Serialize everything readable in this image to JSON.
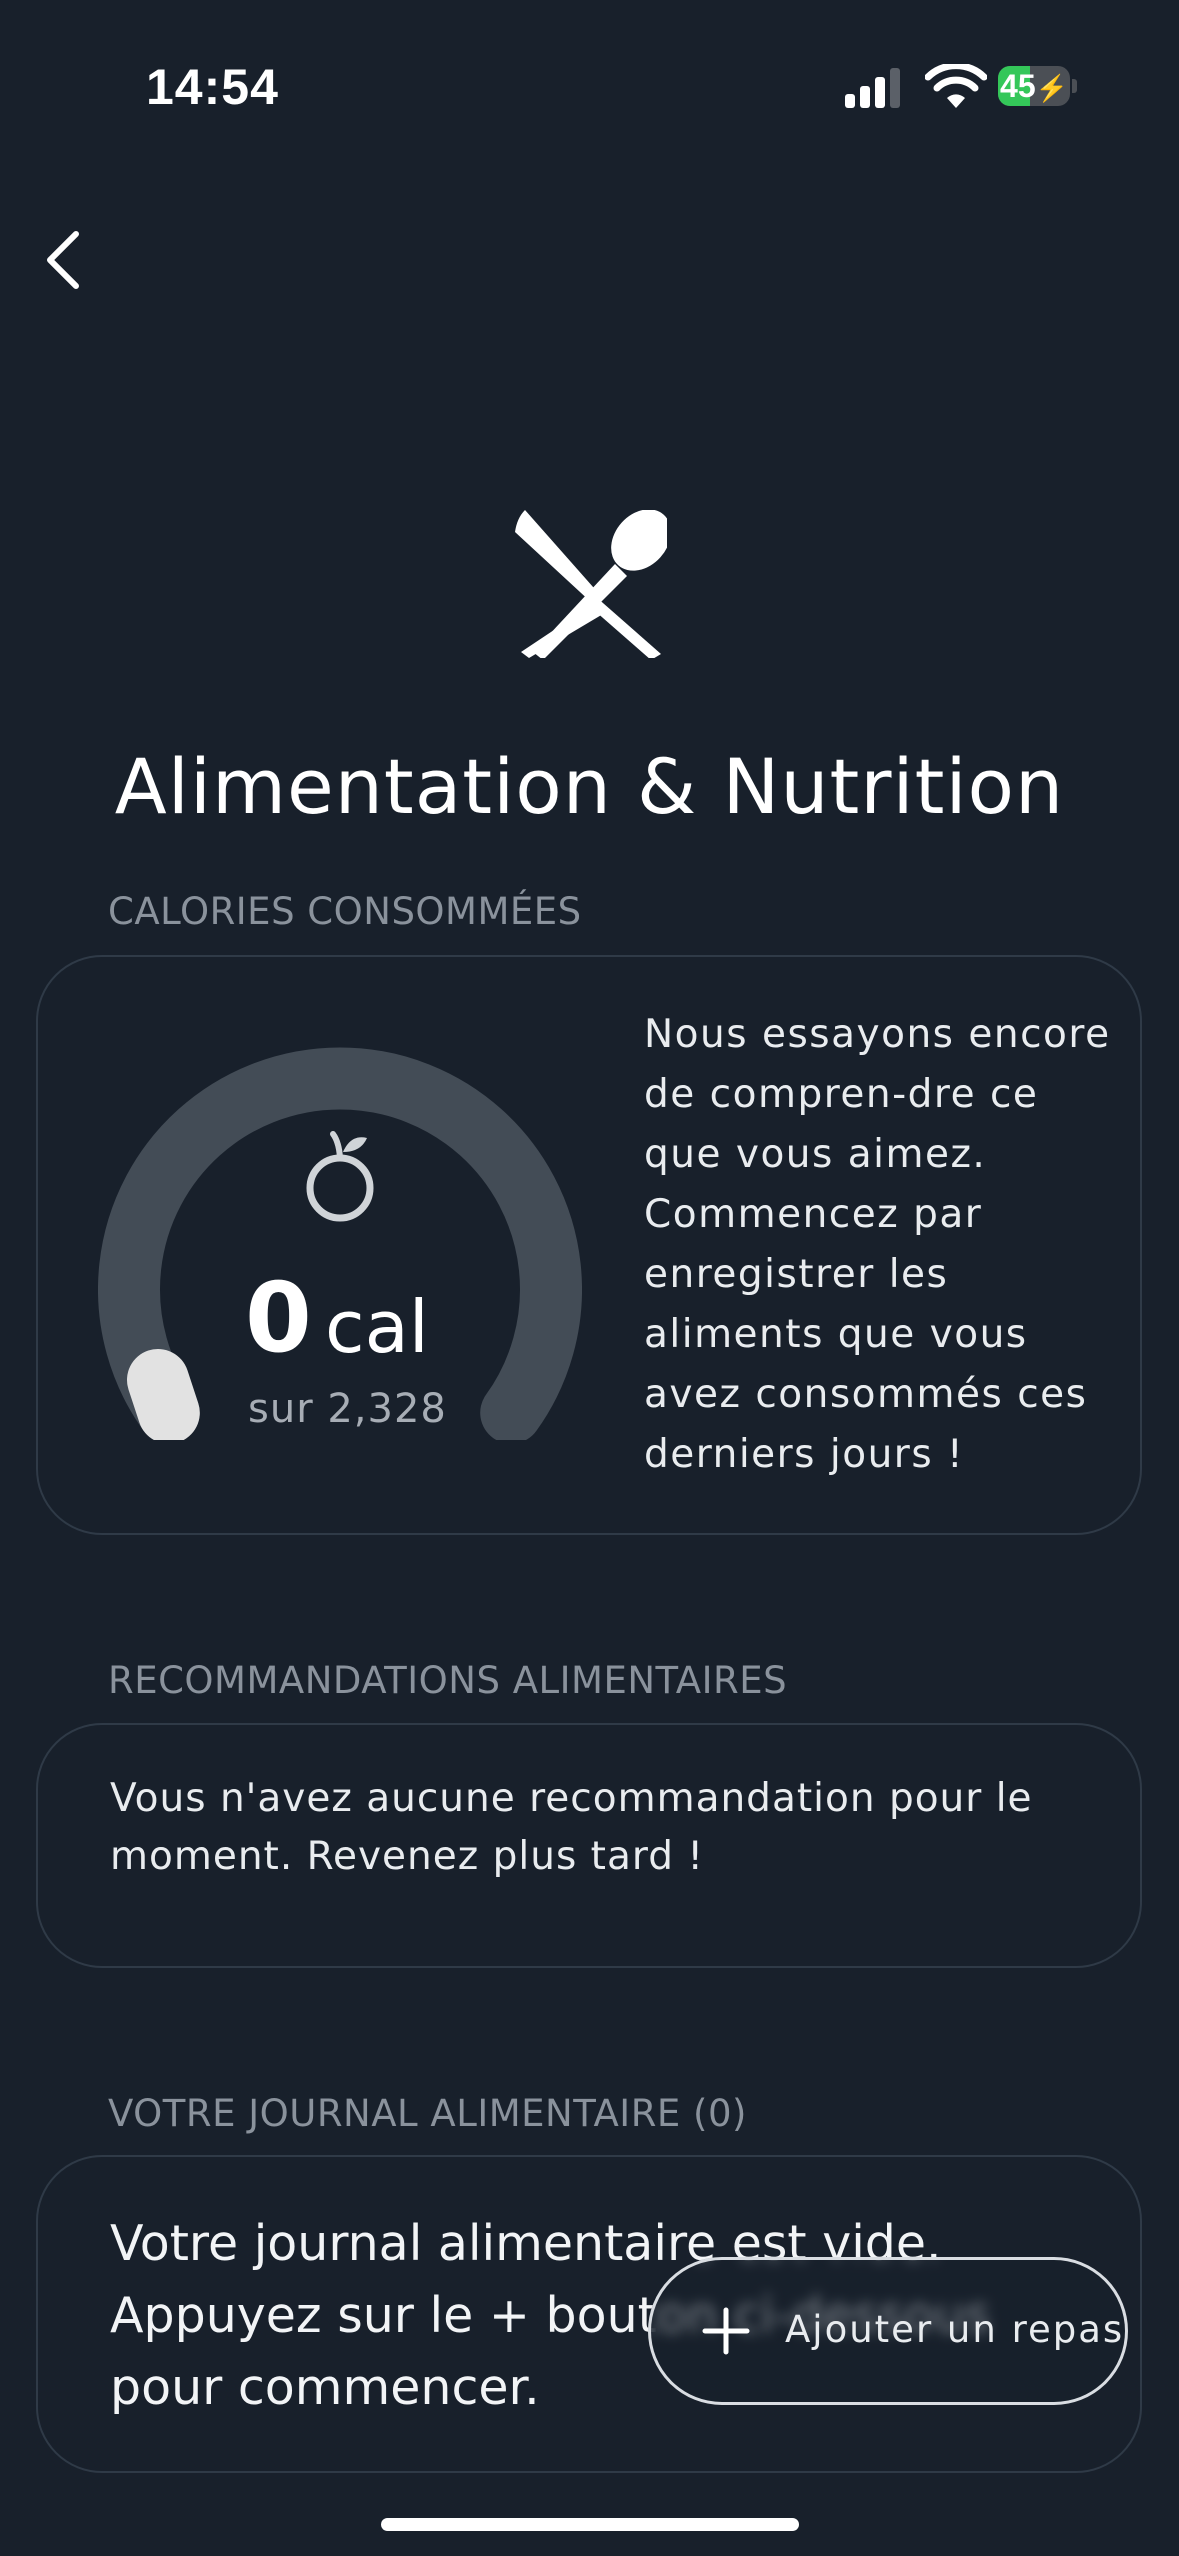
{
  "status_bar": {
    "time": "14:54",
    "battery_level": "45",
    "battery_fill_fraction": 0.45,
    "icons": [
      "signal-icon",
      "wifi-icon",
      "battery-charging-icon"
    ]
  },
  "nav": {
    "back_icon": "chevron-left-icon"
  },
  "header": {
    "icon": "fork-spoon-icon",
    "title": "Alimentation & Nutrition"
  },
  "calories": {
    "section_label": "CALORIES CONSOMMÉES",
    "icon": "apple-icon",
    "value": "0",
    "unit": "cal",
    "subtitle": "sur 2,328",
    "consumed": 0,
    "goal": 2328,
    "message": "Nous essayons encore de compren-dre ce que vous aimez. Commencez par enregistrer les aliments que vous avez consommés ces derniers jours !"
  },
  "recommendations": {
    "section_label": "RECOMMANDATIONS ALIMENTAIRES",
    "text": "Vous n'avez aucune recommandation pour le moment. Revenez plus tard !"
  },
  "journal": {
    "section_label": "VOTRE JOURNAL ALIMENTAIRE (0)",
    "text_before": "Votre journal alimentaire est vide. Appuyez sur le",
    "text_plus": "+",
    "text_after": "bouton ci-dessous pour commencer."
  },
  "fab": {
    "icon": "plus-icon",
    "label": "Ajouter un repas"
  },
  "colors": {
    "background": "#18202b",
    "card_border": "#2f3a47",
    "gauge_track": "#434c56",
    "gauge_progress": "#e2e2e2",
    "battery_green": "#34c759",
    "section_label": "#8a929c"
  }
}
